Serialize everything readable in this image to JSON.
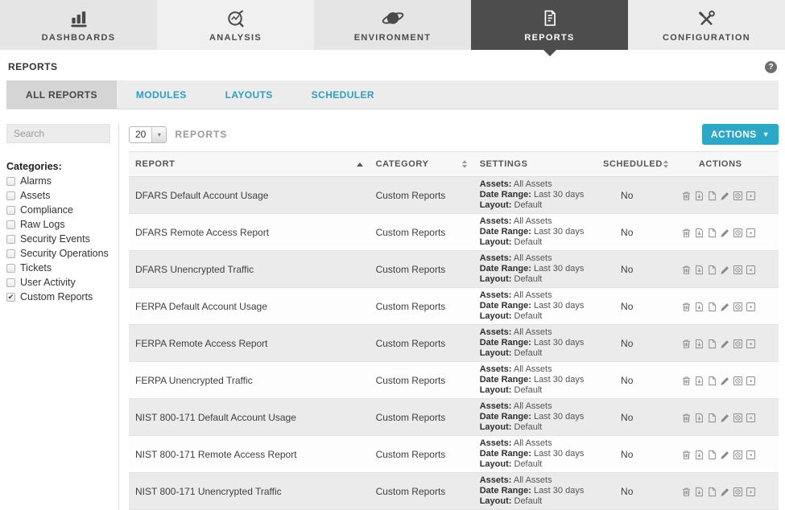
{
  "colors": {
    "accent": "#2ba7c7",
    "nav_active_bg": "#4d4d4d",
    "tab_link": "#2b9fc0"
  },
  "nav": {
    "items": [
      {
        "label": "DASHBOARDS",
        "icon": "bar-chart-icon",
        "active": false
      },
      {
        "label": "ANALYSIS",
        "icon": "analysis-magnifier-icon",
        "active": false
      },
      {
        "label": "ENVIRONMENT",
        "icon": "planet-icon",
        "active": false
      },
      {
        "label": "REPORTS",
        "icon": "report-document-icon",
        "active": true
      },
      {
        "label": "CONFIGURATION",
        "icon": "tools-icon",
        "active": false
      }
    ]
  },
  "page": {
    "title": "REPORTS",
    "help": "?"
  },
  "tabs": [
    {
      "label": "ALL REPORTS",
      "active": true
    },
    {
      "label": "MODULES",
      "active": false
    },
    {
      "label": "LAYOUTS",
      "active": false
    },
    {
      "label": "SCHEDULER",
      "active": false
    }
  ],
  "sidebar": {
    "search_placeholder": "Search",
    "categories_label": "Categories:",
    "categories": [
      {
        "label": "Alarms",
        "checked": false
      },
      {
        "label": "Assets",
        "checked": false
      },
      {
        "label": "Compliance",
        "checked": false
      },
      {
        "label": "Raw Logs",
        "checked": false
      },
      {
        "label": "Security Events",
        "checked": false
      },
      {
        "label": "Security Operations",
        "checked": false
      },
      {
        "label": "Tickets",
        "checked": false
      },
      {
        "label": "User Activity",
        "checked": false
      },
      {
        "label": "Custom Reports",
        "checked": true
      }
    ]
  },
  "toolbar": {
    "page_size": "20",
    "list_label": "REPORTS",
    "actions_label": "ACTIONS"
  },
  "table": {
    "columns": [
      {
        "label": "REPORT",
        "sort": "asc"
      },
      {
        "label": "CATEGORY",
        "sort": "both"
      },
      {
        "label": "SETTINGS",
        "sort": "none"
      },
      {
        "label": "SCHEDULED",
        "sort": "both"
      },
      {
        "label": "ACTIONS",
        "sort": "none"
      }
    ],
    "settings_labels": {
      "assets": "Assets:",
      "date_range": "Date Range:",
      "layout": "Layout:"
    },
    "row_actions": [
      "delete-icon",
      "export-icon",
      "copy-icon",
      "edit-icon",
      "schedule-icon",
      "run-icon"
    ],
    "rows": [
      {
        "report": "DFARS Default Account Usage",
        "category": "Custom Reports",
        "assets": "All Assets",
        "date_range": "Last 30 days",
        "layout": "Default",
        "scheduled": "No"
      },
      {
        "report": "DFARS Remote Access Report",
        "category": "Custom Reports",
        "assets": "All Assets",
        "date_range": "Last 30 days",
        "layout": "Default",
        "scheduled": "No"
      },
      {
        "report": "DFARS Unencrypted Traffic",
        "category": "Custom Reports",
        "assets": "All Assets",
        "date_range": "Last 30 days",
        "layout": "Default",
        "scheduled": "No"
      },
      {
        "report": "FERPA Default Account Usage",
        "category": "Custom Reports",
        "assets": "All Assets",
        "date_range": "Last 30 days",
        "layout": "Default",
        "scheduled": "No"
      },
      {
        "report": "FERPA Remote Access Report",
        "category": "Custom Reports",
        "assets": "All Assets",
        "date_range": "Last 30 days",
        "layout": "Default",
        "scheduled": "No"
      },
      {
        "report": "FERPA Unencrypted Traffic",
        "category": "Custom Reports",
        "assets": "All Assets",
        "date_range": "Last 30 days",
        "layout": "Default",
        "scheduled": "No"
      },
      {
        "report": "NIST 800-171 Default Account Usage",
        "category": "Custom Reports",
        "assets": "All Assets",
        "date_range": "Last 30 days",
        "layout": "Default",
        "scheduled": "No"
      },
      {
        "report": "NIST 800-171 Remote Access Report",
        "category": "Custom Reports",
        "assets": "All Assets",
        "date_range": "Last 30 days",
        "layout": "Default",
        "scheduled": "No"
      },
      {
        "report": "NIST 800-171 Unencrypted Traffic",
        "category": "Custom Reports",
        "assets": "All Assets",
        "date_range": "Last 30 days",
        "layout": "Default",
        "scheduled": "No"
      }
    ]
  }
}
